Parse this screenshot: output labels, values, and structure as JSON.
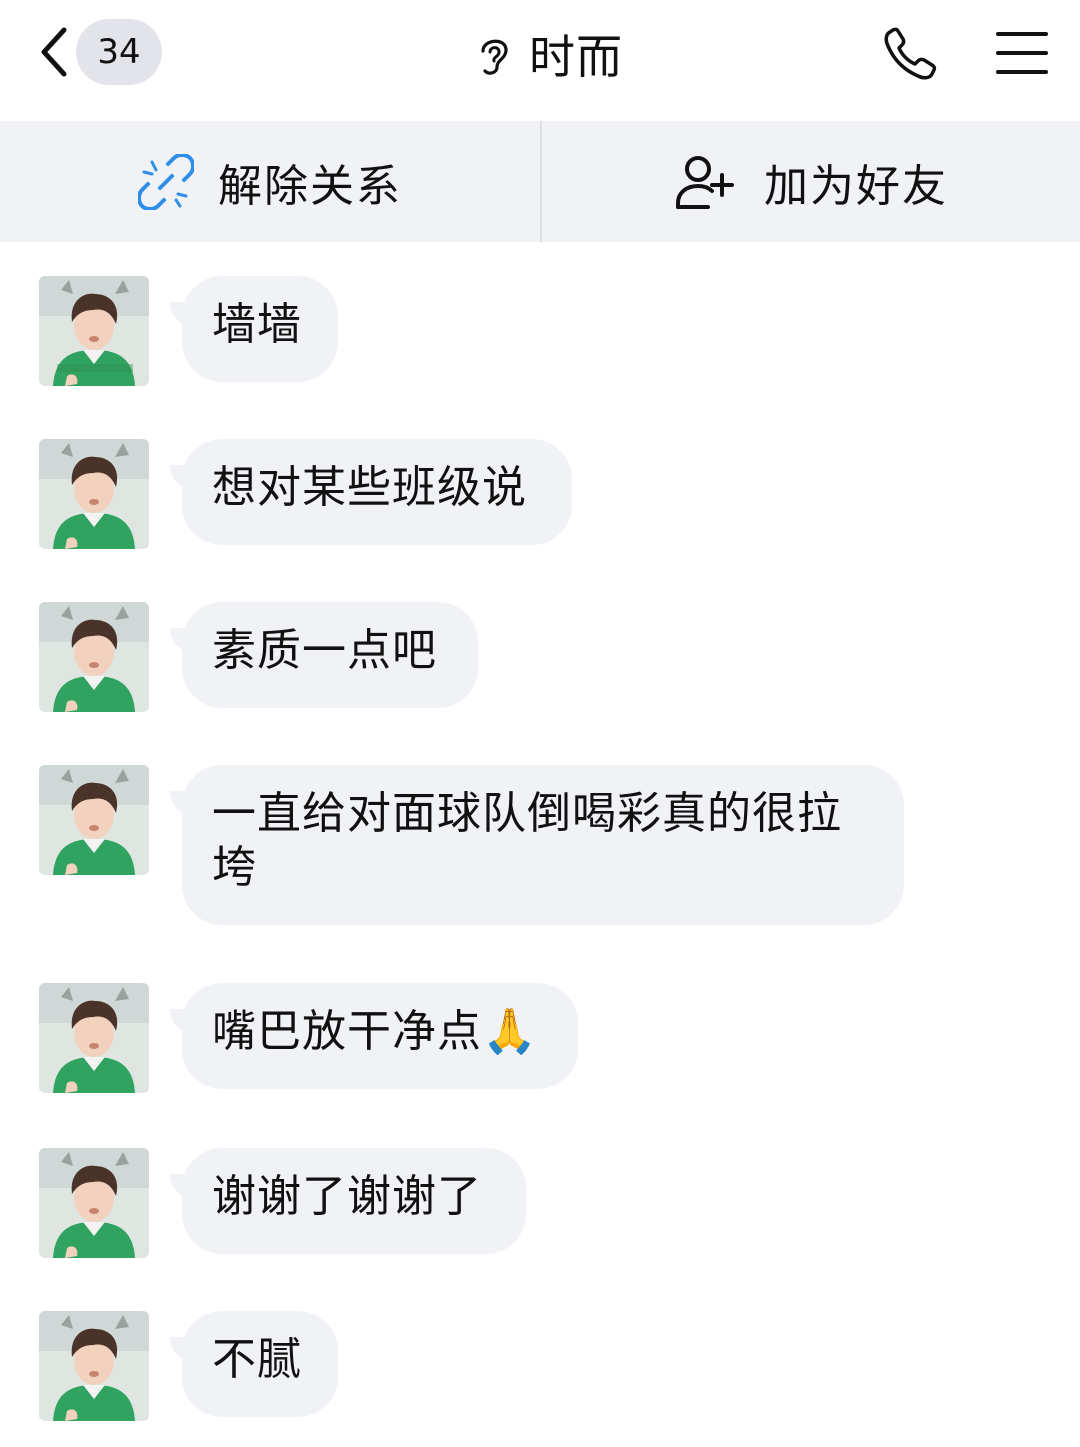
{
  "header": {
    "back_badge": "34",
    "title": "时而"
  },
  "actions": {
    "unlink_label": "解除关系",
    "add_friend_label": "加为好友"
  },
  "colors": {
    "link_icon_blue": "#2f8ee8",
    "bubble_bg": "#f1f2f6",
    "action_bar_bg": "#f1f2f6",
    "badge_bg": "#e3e4e9"
  },
  "icons": {
    "back": "chevron-left-icon",
    "ear": "ear-icon",
    "call": "phone-icon",
    "menu": "hamburger-menu-icon",
    "unlink": "broken-link-icon",
    "add_friend": "add-user-icon"
  },
  "messages": [
    {
      "text": "墙墙"
    },
    {
      "text": "想对某些班级说"
    },
    {
      "text": "素质一点吧"
    },
    {
      "text": "一直给对面球队倒喝彩真的很拉垮"
    },
    {
      "text": "嘴巴放干净点🙏"
    },
    {
      "text": "谢谢了谢谢了"
    },
    {
      "text": "不腻"
    }
  ]
}
